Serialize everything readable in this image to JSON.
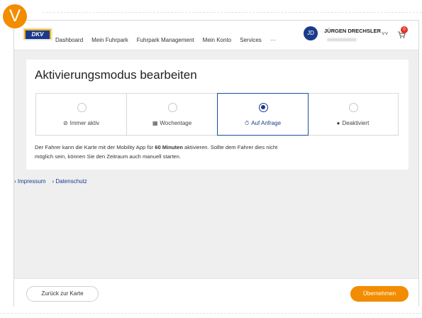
{
  "badge": "V",
  "brand": {
    "logo_text": "DKV"
  },
  "nav": {
    "items": [
      {
        "label": "Dashboard"
      },
      {
        "label": "Mein Fuhrpark"
      },
      {
        "label": "Fuhrpark Management"
      },
      {
        "label": "Mein Konto"
      },
      {
        "label": "Services"
      },
      {
        "label": "···"
      }
    ]
  },
  "user": {
    "initials": "JD",
    "name": "JÜRGEN DRECHSLER",
    "chevron": "˅˅",
    "cart_count": "0"
  },
  "dialog": {
    "title": "Aktivierungsmodus bearbeiten",
    "options": [
      {
        "label": "Immer aktiv",
        "icon": "⊘",
        "icon_name": "check-circle-icon",
        "selected": false
      },
      {
        "label": "Wochentage",
        "icon": "▦",
        "icon_name": "calendar-icon",
        "selected": false
      },
      {
        "label": "Auf Anfrage",
        "icon": "⏱",
        "icon_name": "timer-icon",
        "selected": true
      },
      {
        "label": "Deaktiviert",
        "icon": "●",
        "icon_name": "disabled-icon",
        "selected": false
      }
    ],
    "description_pre": "Der Fahrer kann die Karte mit der Mobility App für ",
    "description_bold": "60 Minuten",
    "description_post": " aktivieren. Sollte dem Fahrer dies nicht möglich sein, können Sie den Zeitraum auch manuell starten."
  },
  "footer": {
    "impressum": "› Impressum",
    "datenschutz": "› Datenschutz"
  },
  "actions": {
    "back_label": "Zurück zur Karte",
    "apply_label": "Übernehmen"
  },
  "colors": {
    "accent": "#f28c00",
    "primary": "#1a3a8c",
    "danger": "#e0332b"
  }
}
